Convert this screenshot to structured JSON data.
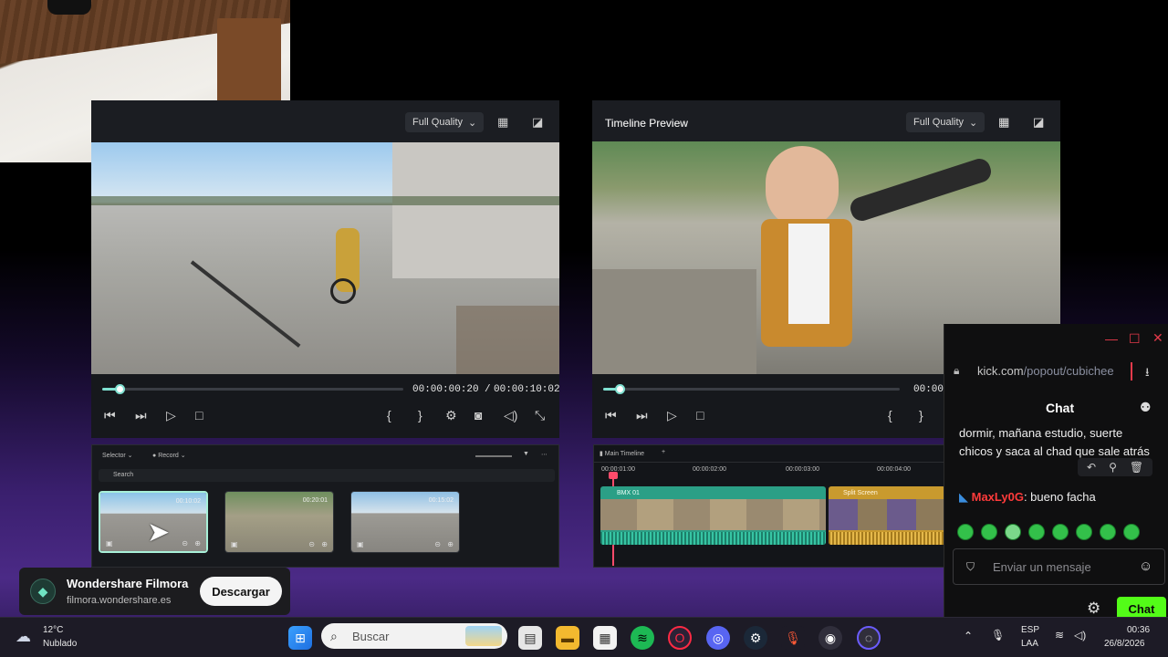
{
  "player_left": {
    "quality": "Full Quality",
    "timecode_current": "00:00:00:20",
    "timecode_total": "00:00:10:02",
    "progress": 0.04
  },
  "player_right": {
    "title": "Timeline Preview",
    "quality": "Full Quality",
    "timecode_current": "00:00",
    "progress": 0.04
  },
  "media_panel": {
    "selector_label": "Selector",
    "record_label": "Record",
    "search_placeholder": "Search",
    "clips": [
      {
        "duration": "00:10:02"
      },
      {
        "duration": "00:20:01"
      },
      {
        "duration": "00:15:02"
      }
    ]
  },
  "timeline": {
    "tab_label": "Main Timeline",
    "ruler": [
      "00:00:01:00",
      "00:00:02:00",
      "00:00:03:00",
      "00:00:04:00"
    ],
    "clip_bmx": "BMX 01",
    "clip_split": "Split Screen"
  },
  "browser": {
    "url_host": "kick.com",
    "url_path": "/popout/cubichee",
    "chat_title": "Chat",
    "message_text": "dormir, mañana estudio, suerte chicos y saca al chad que sale atrás",
    "reply_user": "MaxLy0G",
    "reply_text": ": bueno facha",
    "input_placeholder": "Enviar un mensaje",
    "send_label": "Chat"
  },
  "toast": {
    "app_name": "Wondershare Filmora",
    "domain": "filmora.wondershare.es",
    "button": "Descargar"
  },
  "taskbar": {
    "weather_temp": "12°C",
    "weather_desc": "Nublado",
    "search_placeholder": "Buscar",
    "lang1": "ESP",
    "lang2": "LAA",
    "time": "00:36",
    "date": "26/8/2026"
  }
}
